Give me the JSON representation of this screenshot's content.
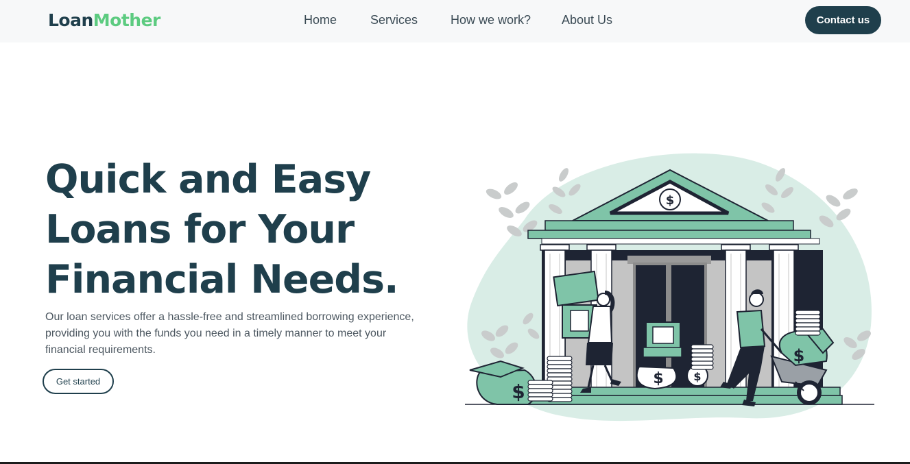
{
  "brand": {
    "part1": "Loan",
    "part2": "Mother"
  },
  "nav": {
    "items": [
      {
        "label": "Home"
      },
      {
        "label": "Services"
      },
      {
        "label": "How we work?"
      },
      {
        "label": "About Us"
      }
    ],
    "contact_label": "Contact us"
  },
  "hero": {
    "title_lines": [
      "Quick and Easy",
      "Loans for Your",
      "Financial Needs."
    ],
    "description": "Our loan services offer a hassle-free and streamlined borrowing experience, providing you with the funds you need in a timely manner to meet your financial requirements.",
    "cta_label": "Get started"
  },
  "illustration": {
    "coin_symbol": "$",
    "bag_symbol": "$"
  },
  "colors": {
    "primary": "#1f3f4c",
    "accent": "#5ccb80",
    "teal": "#7fc4a8",
    "blob": "#d9ede6"
  }
}
